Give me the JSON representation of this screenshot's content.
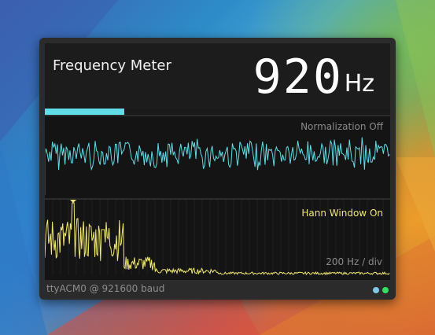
{
  "window": {
    "title": "Frequency Meter",
    "frequency_value": "920",
    "frequency_unit": "Hz"
  },
  "progress": {
    "fraction": 0.23,
    "color": "#62dce6"
  },
  "waveform_panel": {
    "status_label": "Normalization Off",
    "trace_color": "#62dce6"
  },
  "spectrum_panel": {
    "window_label": "Hann Window On",
    "scale_label": "200 Hz / div",
    "trace_color": "#f0e870"
  },
  "status_bar": {
    "port_label": "ttyACM0 @ 921600 baud",
    "indicators": [
      {
        "name": "link-indicator",
        "color": "#7ec8e6"
      },
      {
        "name": "activity-indicator",
        "color": "#36e060"
      }
    ]
  },
  "colors": {
    "background": "#2b2b2b",
    "panel": "#141414",
    "accent": "#62dce6",
    "spectrum": "#f0e870"
  }
}
